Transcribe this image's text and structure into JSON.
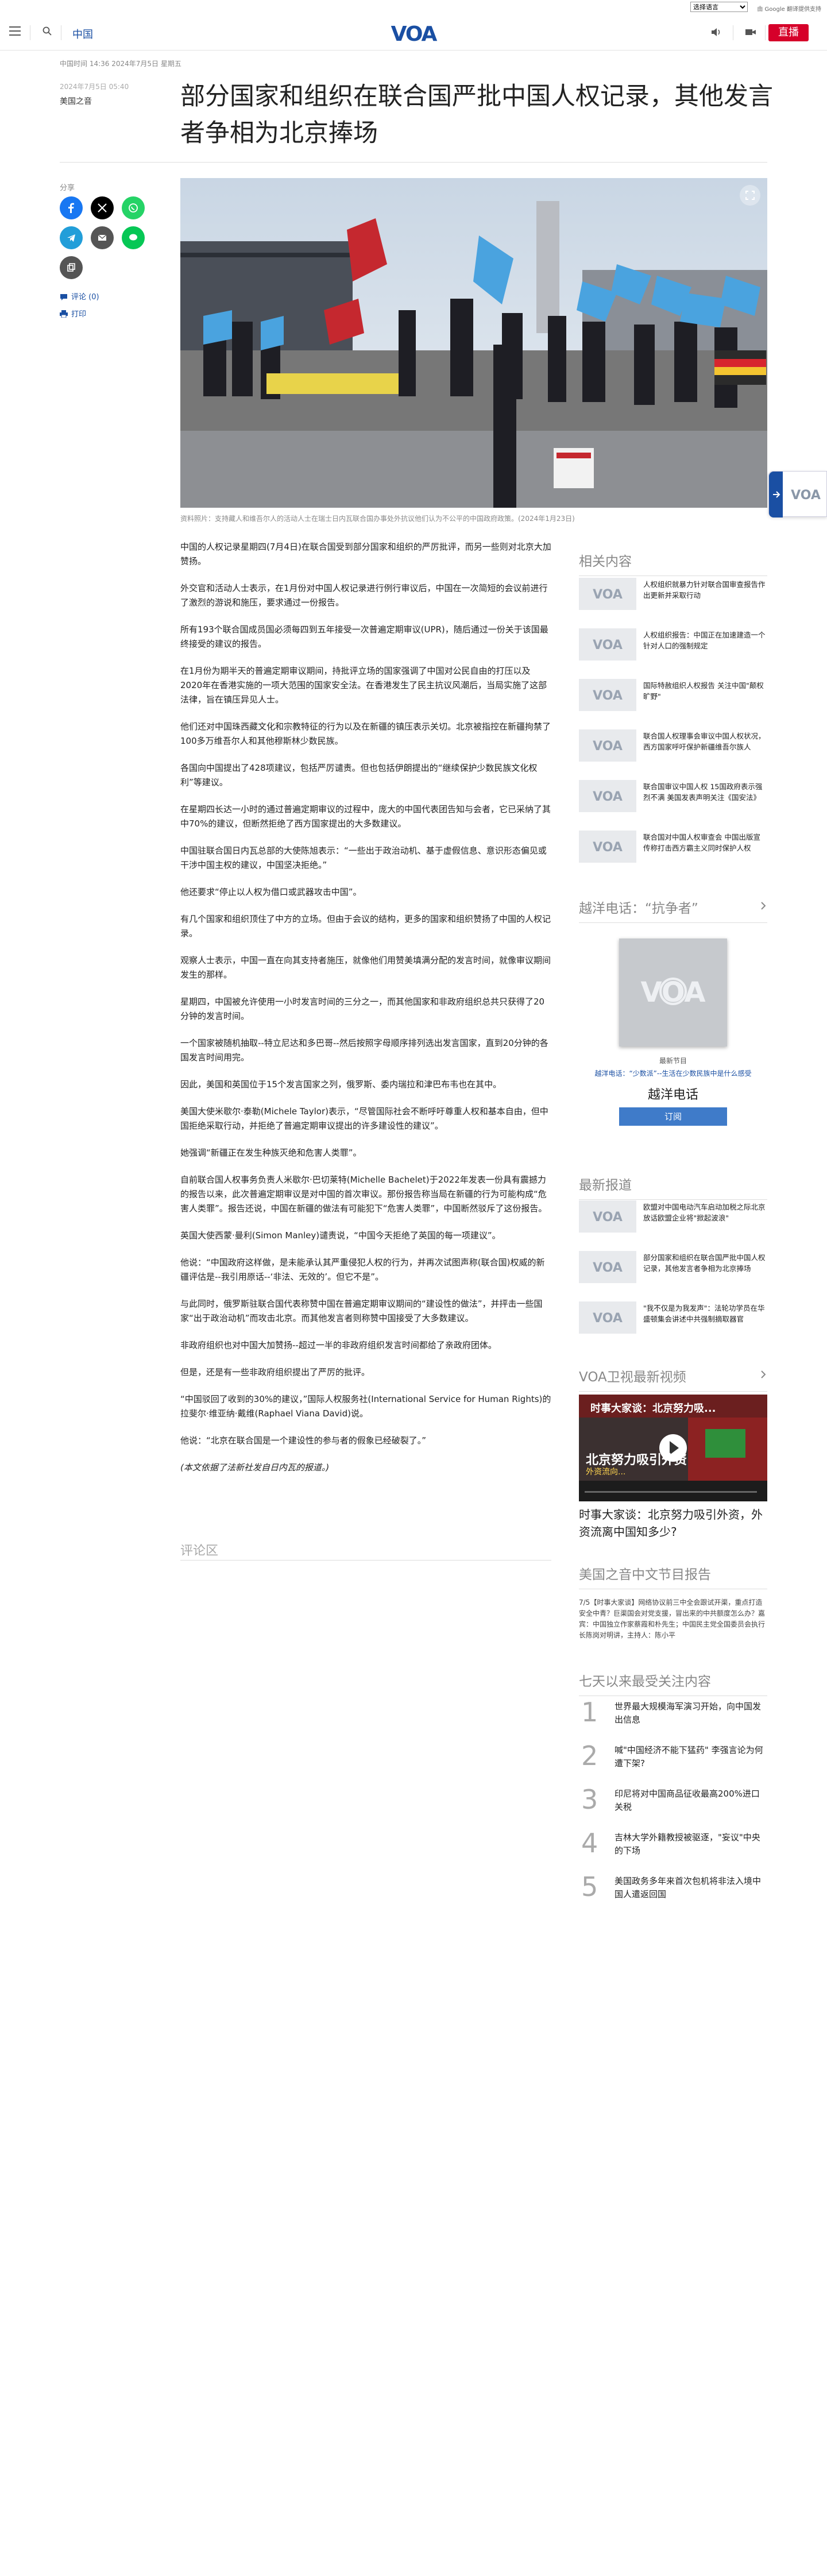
{
  "translate": {
    "select_label": "选择语言",
    "powered_by": "由 Google 翻译提供支持"
  },
  "header": {
    "section": "中国",
    "logo": "VOA",
    "live": "直播"
  },
  "article": {
    "meta_line": "中国时间 14:36 2024年7月5日 星期五",
    "date_small": "2024年7月5日 05:40",
    "byline": "美国之音",
    "headline": "部分国家和组织在联合国严批中国人权记录，其他发言者争相为北京捧场",
    "caption": "资料照片：支持藏人和维吾尔人的活动人士在瑞士日内瓦联合国办事处外抗议他们认为不公平的中国政府政策。(2024年1月23日)",
    "paragraphs": [
      "中国的人权记录星期四(7月4日)在联合国受到部分国家和组织的严厉批评，而另一些则对北京大加赞扬。",
      "外交官和活动人士表示，在1月份对中国人权记录进行例行审议后，中国在一次简短的会议前进行了激烈的游说和施压，要求通过一份报告。",
      "所有193个联合国成员国必须每四到五年接受一次普遍定期审议(UPR)，随后通过一份关于该国最终接受的建议的报告。",
      "在1月份为期半天的普遍定期审议期间，持批评立场的国家强调了中国对公民自由的打压以及2020年在香港实施的一项大范围的国家安全法。在香港发生了民主抗议风潮后，当局实施了这部法律，旨在镇压异见人士。",
      "他们还对中国珠西藏文化和宗教特征的行为以及在新疆的镇压表示关切。北京被指控在新疆拘禁了100多万维吾尔人和其他穆斯林少数民族。",
      "各国向中国提出了428项建议，包括严厉谴责。但也包括伊朗提出的“继续保护少数民族文化权利”等建议。",
      "在星期四长达一小时的通过普遍定期审议的过程中，庞大的中国代表团告知与会者，它已采纳了其中70%的建议，但断然拒绝了西方国家提出的大多数建议。",
      "中国驻联合国日内瓦总部的大使陈旭表示：“一些出于政治动机、基于虚假信息、意识形态偏见或干涉中国主权的建议，中国坚决拒绝。”",
      "他还要求“停止以人权为借口或武器攻击中国”。",
      "有几个国家和组织顶住了中方的立场。但由于会议的结构，更多的国家和组织赞扬了中国的人权记录。",
      "观察人士表示，中国一直在向其支持者施压，就像他们用赞美填满分配的发言时间，就像审议期间发生的那样。",
      "星期四，中国被允许使用一小时发言时间的三分之一，而其他国家和非政府组织总共只获得了20分钟的发言时间。",
      "一个国家被随机抽取--特立尼达和多巴哥--然后按照字母顺序排列选出发言国家，直到20分钟的各国发言时间用完。",
      "因此，美国和英国位于15个发言国家之列，俄罗斯、委内瑞拉和津巴布韦也在其中。",
      "美国大使米歇尔·泰勒(Michele Taylor)表示，“尽管国际社会不断呼吁尊重人权和基本自由，但中国拒绝采取行动，并拒绝了普遍定期审议提出的许多建设性的建议”。",
      "她强调“新疆正在发生种族灭绝和危害人类罪”。",
      "自前联合国人权事务负责人米歇尔·巴切莱特(Michelle Bachelet)于2022年发表一份具有震撼力的报告以来，此次普遍定期审议是对中国的首次审议。那份报告称当局在新疆的行为可能构成“危害人类罪”。报告还说，中国在新疆的做法有可能犯下“危害人类罪”，中国断然驳斥了这份报告。",
      "英国大使西蒙·曼利(Simon Manley)谴责说，“中国今天拒绝了英国的每一项建议”。",
      "他说：“中国政府这样做，是未能承认其严重侵犯人权的行为，并再次试图声称(联合国)权威的新疆评估是--我引用原话--‘非法、无效的’。但它不是”。",
      "与此同时，俄罗斯驻联合国代表称赞中国在普遍定期审议期间的“建设性的做法”，并抨击一些国家“出于政治动机”而攻击北京。而其他发言者则称赞中国接受了大多数建议。",
      "非政府组织也对中国大加赞扬--超过一半的非政府组织发言时间都给了亲政府团体。",
      "但是，还是有一些非政府组织提出了严厉的批评。",
      "“中国驳回了收到的30%的建议，”国际人权服务社(International Service for Human Rights)的拉斐尔·维亚纳·戴维(Raphael Viana David)说。",
      "他说：“北京在联合国是一个建设性的参与者的假象已经破裂了。”"
    ],
    "credit": "(本文依据了法新社发自日内瓦的报道。)"
  },
  "share": {
    "label": "分享",
    "comments": "评论 (0)",
    "print": "打印"
  },
  "comments_title": "评论区",
  "related": {
    "title": "相关内容",
    "items": [
      "人权组织就暴力针对联合国审查报告作出更新并采取行动",
      "人权组织报告：中国正在加速建造一个针对人口的强制规定",
      "国际特赦组织人权报告 关注中国\"颠权旷野\"",
      "联合国人权理事会审议中国人权状况，西方国家呼吁保护新疆维吾尔族人",
      "联合国审议中国人权 15国政府表示强烈不满 美国发表声明关注《国安法》",
      "联合国对中国人权审查会 中国出版宣传称打击西方霸主义同时保护人权"
    ]
  },
  "podcast": {
    "title": "越洋电话：“抗争者”",
    "latest": "最新节目",
    "episode": "越洋电话：“少数派”--生活在少数民族中是什么感受",
    "name": "越洋电话",
    "subscribe": "订阅"
  },
  "latest": {
    "title": "最新报道",
    "items": [
      "欧盟对中国电动汽车启动加税之际北京放话欧盟企业将\"掀起波浪\"",
      "部分国家和组织在联合国严批中国人权记录，其他发言者争相为北京捧场",
      "\"我不仅是为我发声\"：法轮功学员在华盛顿集会讲述中共强制摘取器官"
    ]
  },
  "video": {
    "title": "VOA卫视最新视频",
    "overlay_top": "时事大家谈：北京努力吸...",
    "overlay_mid": "北京努力吸引外资",
    "overlay_sub": "外资流向...",
    "caption": "时事大家谈：北京努力吸引外资，外资流离中国知多少?"
  },
  "doc_report": {
    "title": "美国之音中文节目报告",
    "text": "7/5【时事大家谈】网络协议前三中全会跟试开渠，重点打造安全中青？巨渠国会对党支援，冒出来的中共额度怎么办？嘉宾：中国独立作家蔡霞和朴先生；中国民主党全国委员会执行长陈岗对明讲，主持人：陈小平"
  },
  "popular": {
    "title": "七天以来最受关注内容",
    "items": [
      {
        "num": "1",
        "text": "世界最大规模海军演习开始，向中国发出信息"
      },
      {
        "num": "2",
        "text": "喊\"中国经济不能下猛药\" 李强言论为何遭下架?"
      },
      {
        "num": "3",
        "text": "印尼将对中国商品征收最高200%进口关税"
      },
      {
        "num": "4",
        "text": "吉林大学外籍教授被驱逐，\"妄议\"中央的下场"
      },
      {
        "num": "5",
        "text": "美国政务多年来首次包机将非法入境中国人遣返回国"
      }
    ]
  },
  "colors": {
    "voa_blue": "#1a4fa3",
    "live_red": "#d6002a"
  }
}
